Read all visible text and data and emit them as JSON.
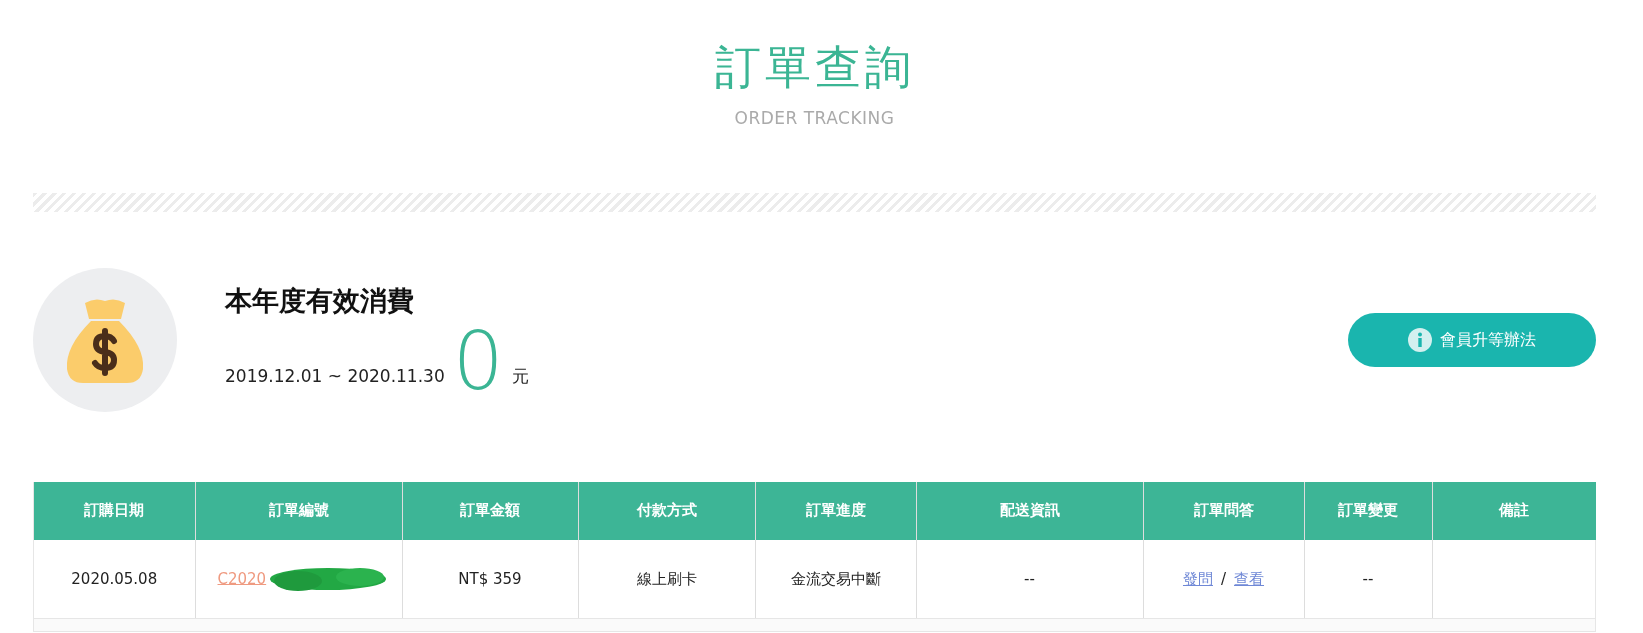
{
  "page_title": "訂單查詢",
  "page_subtitle": "ORDER TRACKING",
  "spending": {
    "label": "本年度有效消費",
    "period": "2019.12.01 ~ 2020.11.30",
    "amount": "0",
    "unit": "元"
  },
  "upgrade_button": {
    "label": "會員升等辦法"
  },
  "table": {
    "columns": [
      "訂購日期",
      "訂單編號",
      "訂單金額",
      "付款方式",
      "訂單進度",
      "配送資訊",
      "訂單問答",
      "訂單變更",
      "備註"
    ],
    "rows": [
      {
        "date": "2020.05.08",
        "order_no": "C2020",
        "amount": "NT$ 359",
        "payment": "線上刷卡",
        "status": "金流交易中斷",
        "shipping": "--",
        "qa": {
          "ask": "發問",
          "separator": "/",
          "view": "查看"
        },
        "change": "--"
      }
    ]
  }
}
